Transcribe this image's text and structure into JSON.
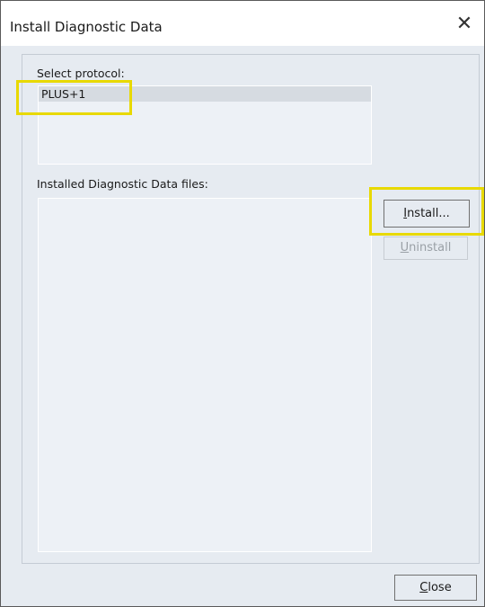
{
  "window": {
    "title": "Install Diagnostic Data",
    "close_glyph": "✕"
  },
  "protocol": {
    "label": "Select protocol:",
    "items": [
      "PLUS+1"
    ]
  },
  "files": {
    "label": "Installed Diagnostic Data files:",
    "items": []
  },
  "buttons": {
    "install": {
      "mnemonic": "I",
      "rest": "nstall...",
      "enabled": true
    },
    "uninstall": {
      "mnemonic": "U",
      "rest": "ninstall",
      "enabled": false
    },
    "close": {
      "mnemonic": "C",
      "rest": "lose",
      "enabled": true
    }
  },
  "highlight_color": "#e8d900"
}
